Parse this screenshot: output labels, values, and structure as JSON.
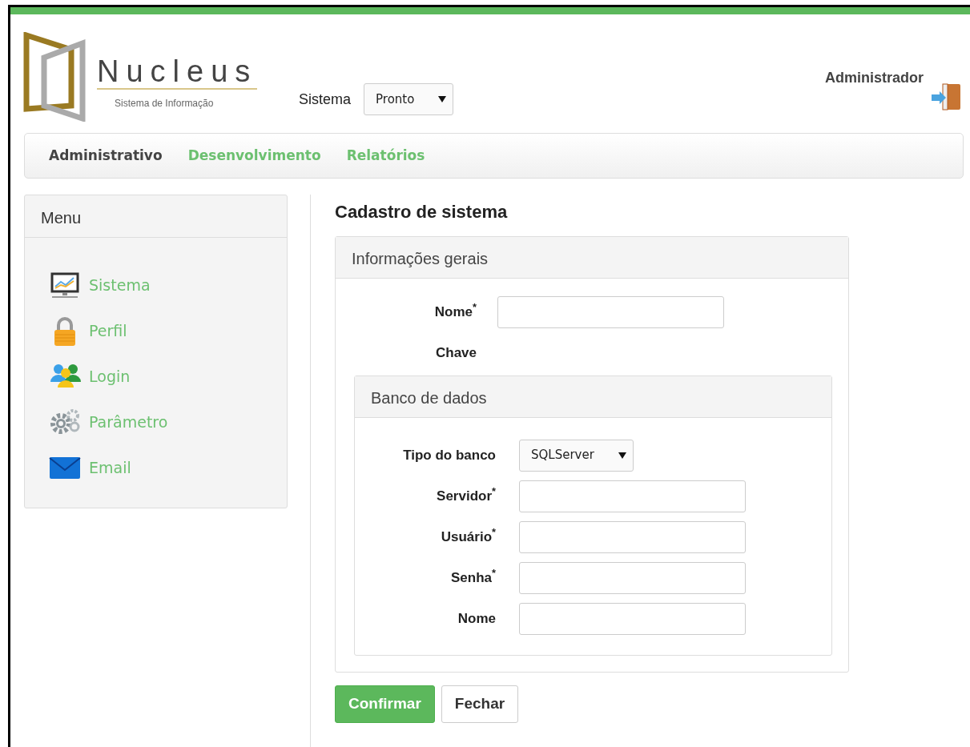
{
  "header": {
    "logo_title": "Nucleus",
    "logo_subtitle": "Sistema de Informação",
    "system_label": "Sistema",
    "system_value": "Pronto",
    "user": "Administrador"
  },
  "nav": [
    {
      "label": "Administrativo",
      "selected": true
    },
    {
      "label": "Desenvolvimento",
      "selected": false
    },
    {
      "label": "Relatórios",
      "selected": false
    }
  ],
  "sidebar": {
    "title": "Menu",
    "items": [
      {
        "label": "Sistema"
      },
      {
        "label": "Perfil"
      },
      {
        "label": "Login"
      },
      {
        "label": "Parâmetro"
      },
      {
        "label": "Email"
      }
    ]
  },
  "form": {
    "title": "Cadastro de sistema",
    "panel_title": "Informações gerais",
    "fields": [
      {
        "label": "Nome$^{*}$",
        "kind": "text"
      },
      {
        "label": "Chave",
        "kind": "static"
      }
    ],
    "database": {
      "title": "Banco de dados",
      "fields": [
        {
          "label": "Tipo do banco",
          "kind": "select",
          "value": "SQLServer"
        },
        {
          "label": "Servidor$^{*}$",
          "kind": "text"
        },
        {
          "label": "Usuário$^{*}$",
          "kind": "text"
        },
        {
          "label": "Senha$^{*}$",
          "kind": "text"
        },
        {
          "label": "Nome",
          "kind": "text"
        }
      ]
    },
    "buttons": [
      {
        "label": "Confirmar",
        "kind": "primary"
      },
      {
        "label": "Fechar",
        "kind": "default"
      }
    ]
  }
}
